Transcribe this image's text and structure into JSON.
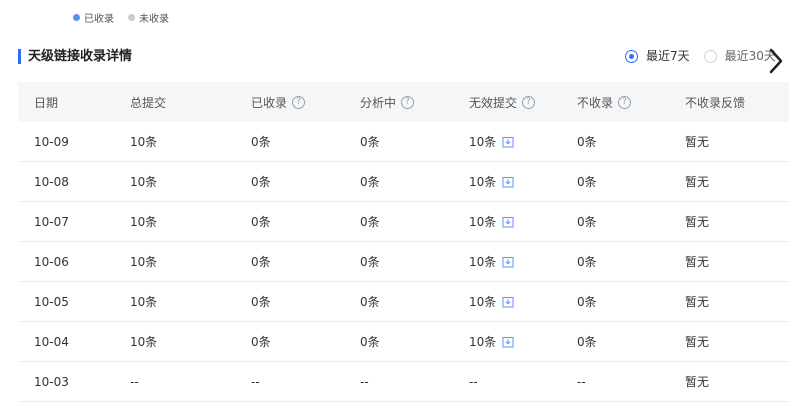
{
  "legend": [
    {
      "label": "已收录",
      "color": "#5b8ff9"
    },
    {
      "label": "未收录",
      "color": "#c9cdd4"
    }
  ],
  "section": {
    "title": "天级链接收录详情",
    "range_options": [
      {
        "label": "最近7天",
        "selected": true
      },
      {
        "label": "最近30天",
        "selected": false
      }
    ]
  },
  "table": {
    "headers": [
      "日期",
      "总提交",
      "已收录",
      "分析中",
      "无效提交",
      "不收录",
      "不收录反馈"
    ],
    "header_help": [
      false,
      false,
      true,
      true,
      true,
      true,
      false
    ],
    "rows": [
      [
        "10-09",
        "10条",
        "0条",
        "0条",
        "10条",
        "0条",
        "暂无"
      ],
      [
        "10-08",
        "10条",
        "0条",
        "0条",
        "10条",
        "0条",
        "暂无"
      ],
      [
        "10-07",
        "10条",
        "0条",
        "0条",
        "10条",
        "0条",
        "暂无"
      ],
      [
        "10-06",
        "10条",
        "0条",
        "0条",
        "10条",
        "0条",
        "暂无"
      ],
      [
        "10-05",
        "10条",
        "0条",
        "0条",
        "10条",
        "0条",
        "暂无"
      ],
      [
        "10-04",
        "10条",
        "0条",
        "0条",
        "10条",
        "0条",
        "暂无"
      ],
      [
        "10-03",
        "--",
        "--",
        "--",
        "--",
        "--",
        "暂无"
      ]
    ],
    "help_glyph": "?"
  },
  "colors": {
    "accent": "#2f6bff",
    "header_bg": "#f5f6f8",
    "download_icon": "#5b8ff9"
  }
}
